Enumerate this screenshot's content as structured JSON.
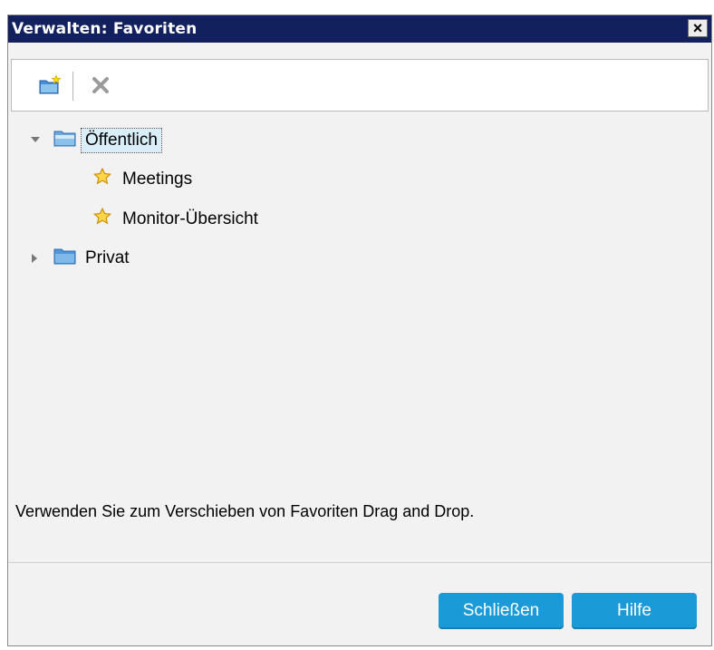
{
  "dialog": {
    "title": "Verwalten: Favoriten",
    "close_label": "×"
  },
  "toolbar": {
    "new_folder_icon": "new-folder-icon",
    "delete_icon": "delete-icon"
  },
  "tree": {
    "public_folder": {
      "label": "Öffentlich",
      "expanded": true,
      "selected": true,
      "items": [
        {
          "label": "Meetings",
          "icon": "star-icon"
        },
        {
          "label": "Monitor-Übersicht",
          "icon": "star-icon"
        }
      ]
    },
    "private_folder": {
      "label": "Privat",
      "expanded": false
    }
  },
  "hint": "Verwenden Sie zum Verschieben von Favoriten Drag and Drop.",
  "buttons": {
    "close": "Schließen",
    "help": "Hilfe"
  },
  "colors": {
    "titlebar": "#12205e",
    "button": "#1a9bd8",
    "selection": "#d9eef9"
  }
}
